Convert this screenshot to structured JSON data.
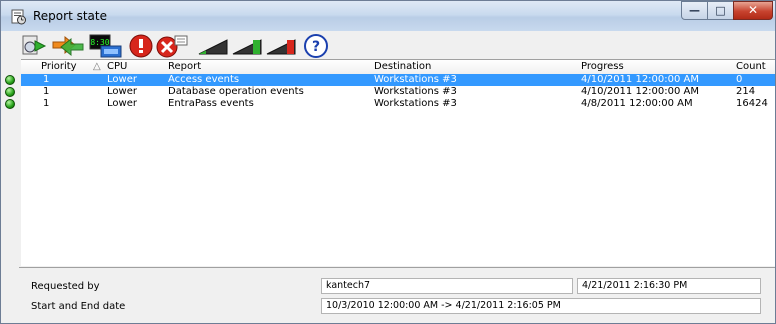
{
  "window": {
    "title": "Report state",
    "controls": {
      "minimize": "—",
      "maximize": "□",
      "close": "✕"
    }
  },
  "toolbar": {
    "icons": [
      "report-go-icon",
      "refresh-arrows-icon",
      "scheduled-clock-icon",
      "stop-icon",
      "cancel-icon",
      "priority-lowest-icon",
      "priority-low-icon",
      "priority-high-icon",
      "help-icon"
    ],
    "clock_text": "8:30",
    "help_glyph": "?"
  },
  "table": {
    "columns": [
      "Priority",
      "CPU",
      "Report",
      "Destination",
      "Progress",
      "Count"
    ],
    "sort_indicator": "△",
    "rows": [
      {
        "priority": "1",
        "cpu": "Lower",
        "report": "Access events",
        "destination": "Workstations #3",
        "progress": "4/10/2011 12:00:00 AM",
        "count": "0",
        "selected": true
      },
      {
        "priority": "1",
        "cpu": "Lower",
        "report": "Database operation events",
        "destination": "Workstations #3",
        "progress": "4/10/2011 12:00:00 AM",
        "count": "214",
        "selected": false
      },
      {
        "priority": "1",
        "cpu": "Lower",
        "report": "EntraPass events",
        "destination": "Workstations #3",
        "progress": "4/8/2011 12:00:00 AM",
        "count": "16424",
        "selected": false
      }
    ]
  },
  "details": {
    "requested_by_label": "Requested by",
    "requested_by_value": "kantech7",
    "requested_at_value": "4/21/2011 2:16:30 PM",
    "start_end_label": "Start and End date",
    "start_end_value": "10/3/2010 12:00:00 AM -> 4/21/2011 2:16:05 PM"
  },
  "colors": {
    "selection": "#3399ff",
    "title_gradient_mid": "#b9cde6",
    "close_button": "#c7432f",
    "status_dot": "#27a21a"
  }
}
